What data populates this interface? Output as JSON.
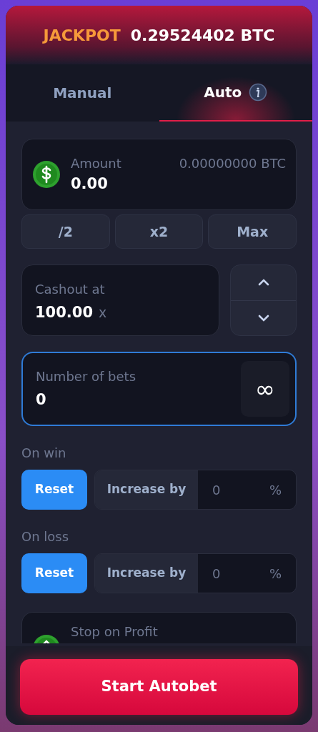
{
  "jackpot": {
    "label": "JACKPOT",
    "amount": "0.29524402 BTC"
  },
  "tabs": [
    {
      "label": "Manual",
      "selected": false,
      "info": false
    },
    {
      "label": "Auto",
      "selected": true,
      "info": true
    }
  ],
  "amount": {
    "label": "Amount",
    "value": "0.00",
    "conversion": "0.00000000 BTC"
  },
  "quick_buttons": [
    "/2",
    "x2",
    "Max"
  ],
  "cashout": {
    "label": "Cashout at",
    "value": "100.00",
    "suffix": "x"
  },
  "bets": {
    "label": "Number of bets",
    "value": "0",
    "focused": true,
    "infinity": "∞"
  },
  "conditions": [
    {
      "label": "On win",
      "options": [
        {
          "label": "Reset",
          "selected": true
        },
        {
          "label": "Increase by",
          "selected": false
        }
      ],
      "placeholder": "0",
      "unit": "%"
    },
    {
      "label": "On loss",
      "options": [
        {
          "label": "Reset",
          "selected": true
        },
        {
          "label": "Increase by",
          "selected": false
        }
      ],
      "placeholder": "0",
      "unit": "%"
    }
  ],
  "stop_profit": {
    "label": "Stop on Profit"
  },
  "start_button": "Start Autobet"
}
